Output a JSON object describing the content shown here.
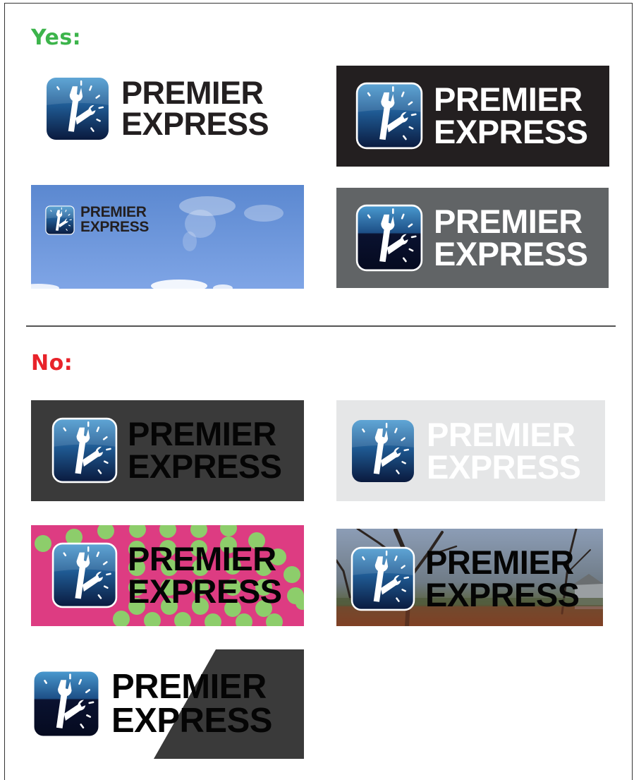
{
  "sections": {
    "yes_label": "Yes:",
    "no_label": "No:"
  },
  "logo": {
    "line1": "PREMIER",
    "line2": "EXPRESS",
    "icon": "clock-wrench-app-icon"
  },
  "colors": {
    "yes_heading": "#3cb44b",
    "no_heading": "#e8232a",
    "icon_top": "#3f8fc6",
    "icon_bottom": "#0c1e44",
    "panel_black": "#231f20",
    "panel_gray": "#616466",
    "panel_dark_gray": "#3a3a3a",
    "panel_light_gray": "#e5e6e7",
    "panel_pink": "#dd3c82",
    "dot_green": "#8dcd6b",
    "sky_blue": "#5f8fd6"
  }
}
